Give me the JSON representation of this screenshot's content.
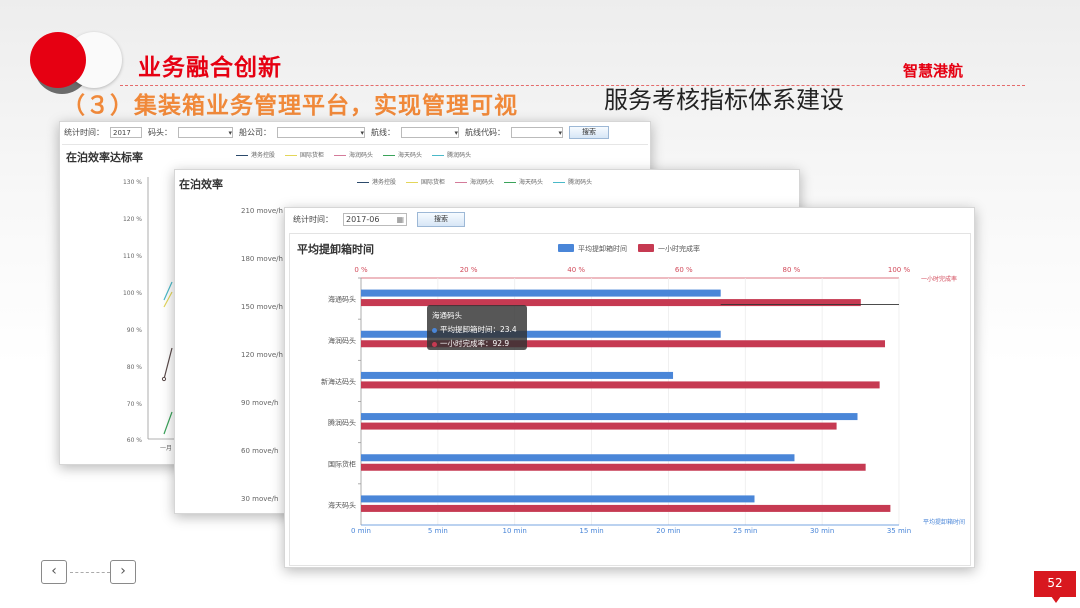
{
  "header": {
    "section_title": "业务融合创新",
    "brand": "智慧港航",
    "subtitle": "（３）集装箱业务管理平台，实现管理可视",
    "headline": "服务考核指标体系建设"
  },
  "colors": {
    "accent": "#e60012",
    "subtitle": "#f0893a",
    "bar_blue": "#4a86d8",
    "bar_red": "#c63a52"
  },
  "card1": {
    "toolbar": {
      "time_label": "统计时间：",
      "time_value": "2017",
      "dock_label": "码头：",
      "company_label": "船公司：",
      "route_label": "航线：",
      "route_code_label": "航线代码：",
      "search_label": "搜索"
    },
    "title": "在泊效率达标率",
    "legend": [
      "港务控股",
      "国际货柜",
      "海润码头",
      "海天码头",
      "腾润码头"
    ],
    "y_ticks": [
      "130 %",
      "120 %",
      "110 %",
      "100 %",
      "90 %",
      "80 %",
      "70 %",
      "60 %"
    ],
    "x_first": "一月"
  },
  "card2": {
    "title": "在泊效率",
    "legend": [
      "港务控股",
      "国际货柜",
      "海润码头",
      "海天码头",
      "腾润码头"
    ],
    "y_ticks": [
      "210 move/h",
      "180 move/h",
      "150 move/h",
      "120 move/h",
      "90 move/h",
      "60 move/h",
      "30 move/h"
    ]
  },
  "card3": {
    "toolbar": {
      "time_label": "统计时间：",
      "time_value": "2017-06",
      "search_label": "搜索"
    },
    "tooltip": {
      "title": "海通码头",
      "line1": "平均提卸箱时间：23.4",
      "line2": "一小时完成率：92.9"
    }
  },
  "chart_data": {
    "type": "bar",
    "orientation": "horizontal",
    "title": "平均提卸箱时间",
    "categories": [
      "海通码头",
      "海润码头",
      "新海达码头",
      "腾润码头",
      "国际货柜",
      "海天码头"
    ],
    "series": [
      {
        "name": "平均提卸箱时间",
        "color": "#4a86d8",
        "axis": "bottom",
        "values": [
          23.4,
          23.4,
          20.3,
          32.3,
          28.2,
          25.6
        ]
      },
      {
        "name": "一小时完成率",
        "color": "#c63a52",
        "axis": "top",
        "values": [
          92.9,
          97.4,
          96.4,
          88.4,
          93.8,
          98.4
        ]
      }
    ],
    "bottom_axis": {
      "label": "平均提卸箱时间",
      "ticks": [
        "0 min",
        "5 min",
        "10 min",
        "15 min",
        "20 min",
        "25 min",
        "30 min",
        "35 min"
      ],
      "range": [
        0,
        35
      ]
    },
    "top_axis": {
      "label": "一小时完成率",
      "ticks": [
        "0 %",
        "20 %",
        "40 %",
        "60 %",
        "80 %",
        "100 %"
      ],
      "range": [
        0,
        100
      ]
    },
    "legend_position": "top-center"
  },
  "footer": {
    "prev_icon": "chevron-left-icon",
    "next_icon": "chevron-right-icon",
    "page_number": "52"
  }
}
